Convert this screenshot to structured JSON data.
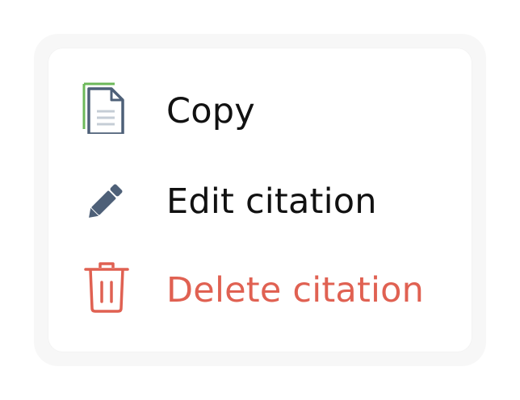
{
  "menu": {
    "items": [
      {
        "label": "Copy",
        "icon": "copy-icon"
      },
      {
        "label": "Edit citation",
        "icon": "pencil-icon"
      },
      {
        "label": "Delete citation",
        "icon": "trash-icon"
      }
    ]
  },
  "colors": {
    "text": "#111111",
    "danger": "#e06152",
    "icon_dark": "#4e6078",
    "icon_accent": "#6cb85a"
  }
}
